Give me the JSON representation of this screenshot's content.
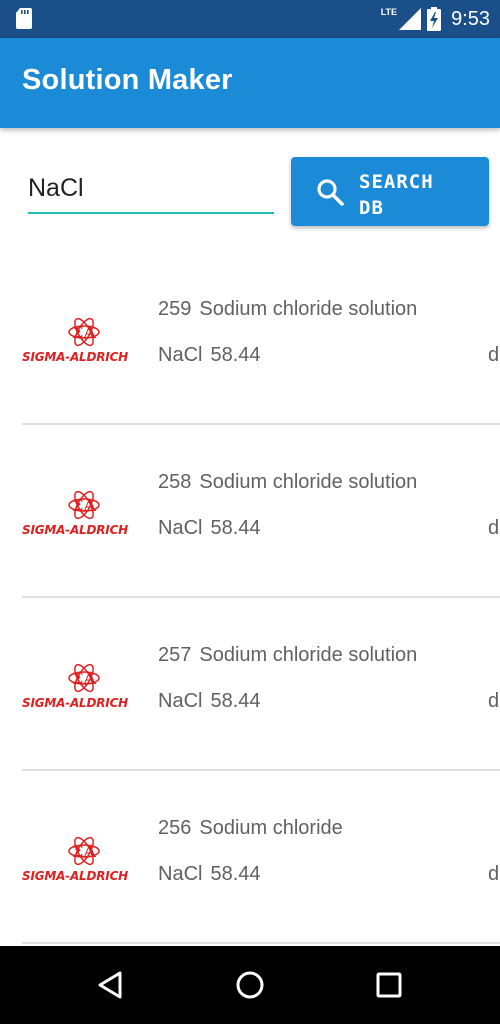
{
  "status_bar": {
    "network": "LTE",
    "time": "9:53"
  },
  "app_bar": {
    "title": "Solution Maker"
  },
  "search": {
    "value": "NaCl",
    "button_label": "SEARCH\nDB",
    "button_icon": "search-icon"
  },
  "results": [
    {
      "id": "259",
      "name": "Sodium chloride solution",
      "formula": "NaCl",
      "mw": "58.44",
      "overflow": "d",
      "brand": "SIGMA-ALDRICH"
    },
    {
      "id": "258",
      "name": "Sodium chloride solution",
      "formula": "NaCl",
      "mw": "58.44",
      "overflow": "d",
      "brand": "SIGMA-ALDRICH"
    },
    {
      "id": "257",
      "name": "Sodium chloride solution",
      "formula": "NaCl",
      "mw": "58.44",
      "overflow": "d",
      "brand": "SIGMA-ALDRICH"
    },
    {
      "id": "256",
      "name": "Sodium chloride",
      "formula": "NaCl",
      "mw": "58.44",
      "overflow": "d",
      "brand": "SIGMA-ALDRICH"
    }
  ],
  "colors": {
    "status_bar": "#1a4f8a",
    "primary": "#1b8ad7",
    "input_underline": "#1fbeb0",
    "brand_red": "#e02020",
    "text_secondary": "#616161"
  },
  "nav_bar": {
    "back": "back-icon",
    "home": "home-icon",
    "recents": "recents-icon"
  }
}
